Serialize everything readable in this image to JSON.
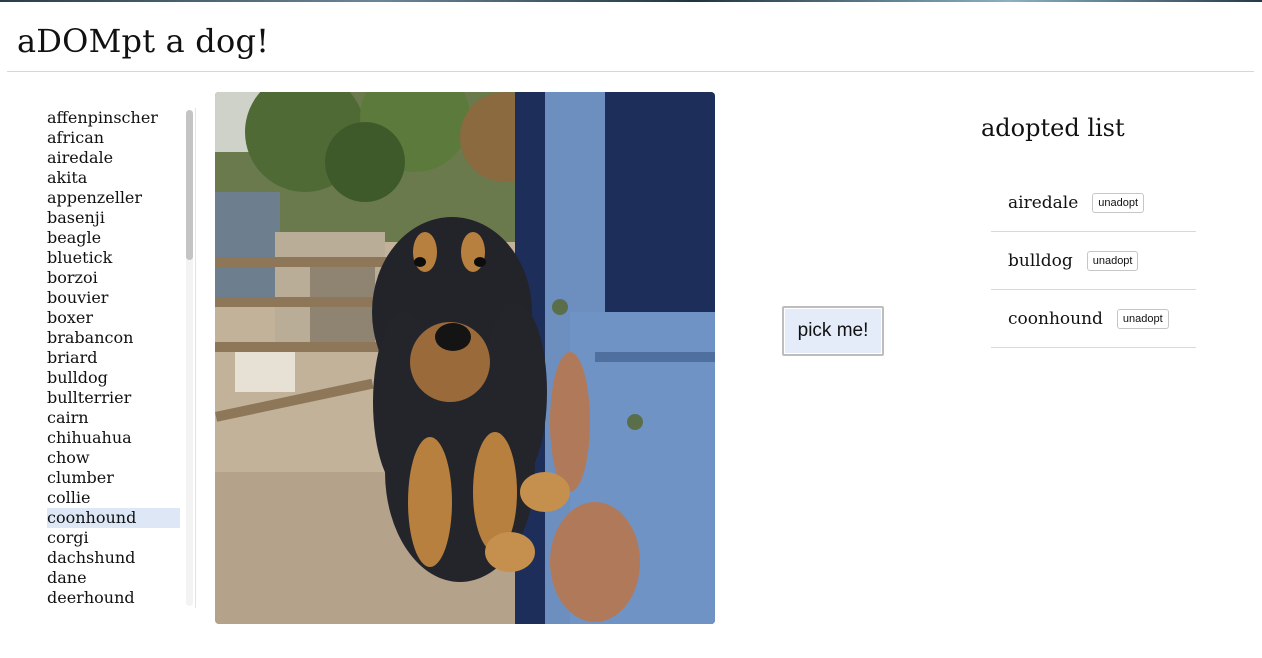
{
  "app": {
    "title": "aDOMpt a dog!"
  },
  "breeds": [
    "affenpinscher",
    "african",
    "airedale",
    "akita",
    "appenzeller",
    "basenji",
    "beagle",
    "bluetick",
    "borzoi",
    "bouvier",
    "boxer",
    "brabancon",
    "briard",
    "bulldog",
    "bullterrier",
    "cairn",
    "chihuahua",
    "chow",
    "clumber",
    "collie",
    "coonhound",
    "corgi",
    "dachshund",
    "dane",
    "deerhound"
  ],
  "selected_breed_index": 20,
  "pick_button": {
    "label": "pick me!"
  },
  "adopted": {
    "title": "adopted list",
    "unadopt_label": "unadopt",
    "items": [
      "airedale",
      "bulldog",
      "coonhound"
    ]
  }
}
